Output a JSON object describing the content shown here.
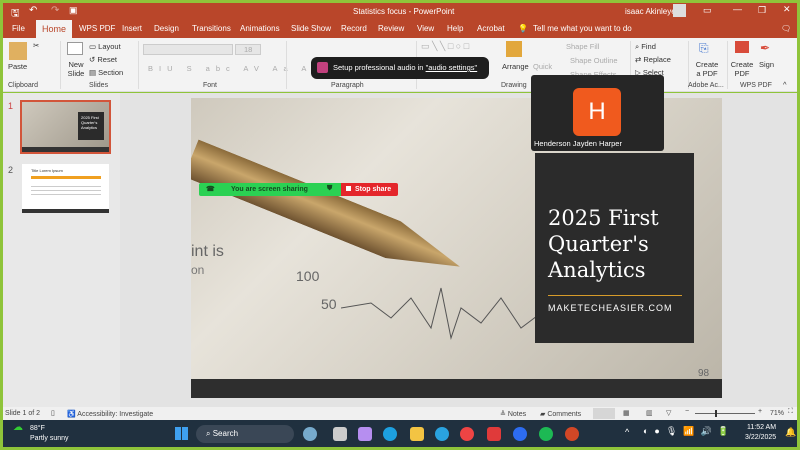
{
  "window": {
    "title": "Statistics focus  -  PowerPoint",
    "user": "isaac Akinleye"
  },
  "tabs": [
    "File",
    "Home",
    "WPS PDF",
    "Insert",
    "Design",
    "Transitions",
    "Animations",
    "Slide Show",
    "Record",
    "Review",
    "View",
    "Help",
    "Acrobat"
  ],
  "tell_me": "Tell me what you want to do",
  "ribbon": {
    "paste": "Paste",
    "new_slide": "New Slide",
    "layout": "Layout",
    "reset": "Reset",
    "section": "Section",
    "font_size": "18",
    "arrange": "Arrange",
    "quick": "Quick",
    "shape_fill": "Shape Fill",
    "shape_outline": "Shape Outline",
    "shape_effects": "Shape Effects",
    "find": "Find",
    "replace": "Replace",
    "select": "Select",
    "create_a_pdf": "Create a PDF",
    "create_pdf": "Create PDF",
    "sign": "Sign",
    "groups": {
      "clipboard": "Clipboard",
      "slides": "Slides",
      "font": "Font",
      "paragraph": "Paragraph",
      "drawing": "Drawing",
      "adobe": "Adobe Ac...",
      "wps": "WPS PDF"
    }
  },
  "audio_toast": {
    "text": "Setup professional audio in ",
    "link": "\"audio settings\""
  },
  "video_tile": {
    "initial": "H",
    "name": "Henderson Jayden Harper",
    "color": "#f05a1e"
  },
  "thumbnails": [
    {
      "num": "1",
      "title": "2025 First Quarter's Analytics"
    },
    {
      "num": "2",
      "title": "Title Lorem Ipsum"
    }
  ],
  "share_bar": {
    "text": "You are screen sharing",
    "stop": "Stop share"
  },
  "slide": {
    "title": "2025 First Quarter's Analytics",
    "subtitle": "MAKETECHEASIER.COM",
    "bg_text": [
      "int is",
      "on",
      "100",
      "50",
      "98"
    ]
  },
  "status": {
    "slide": "Slide 1 of 2",
    "accessibility": "Accessibility: Investigate",
    "notes": "Notes",
    "comments": "Comments",
    "zoom": "71%",
    "zoom_level": 71
  },
  "taskbar": {
    "temp": "88°F",
    "weather": "Partly sunny",
    "search": "Search",
    "time": "11:52 AM",
    "date": "3/22/2025"
  }
}
